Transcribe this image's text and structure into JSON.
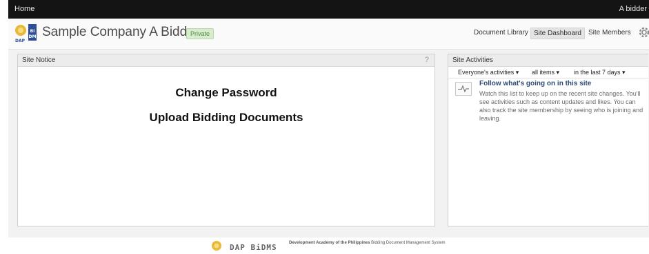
{
  "topbar": {
    "home": "Home",
    "user": "A bidder"
  },
  "header": {
    "site_title": "Sample Company A Bidder",
    "privacy_badge": "Private",
    "nav": [
      "Document Library",
      "Site Dashboard",
      "Site Members"
    ],
    "logo_text": "BiDMS",
    "logo_sub": "DAP"
  },
  "site_notice": {
    "title": "Site Notice",
    "help": "?",
    "line1": "Change Password",
    "line2": "Upload Bidding Documents"
  },
  "site_activities": {
    "title": "Site Activities",
    "filters": [
      "Everyone's activities",
      "all items",
      "in the last 7 days"
    ],
    "heading": "Follow what's going on in this site",
    "body": "Watch this list to keep up on the recent site changes. You'll see activities such as content updates and likes. You can also track the site membership by seeing who is joining and leaving."
  },
  "footer": {
    "logo_text": "DAP BiDMS",
    "org_bold": "Development Academy of the Philippines",
    "org_rest": " Bidding Document Management System"
  },
  "colors": {
    "topbar": "#141414",
    "badge_bg": "#d8edd0",
    "link": "#2e4b74"
  }
}
